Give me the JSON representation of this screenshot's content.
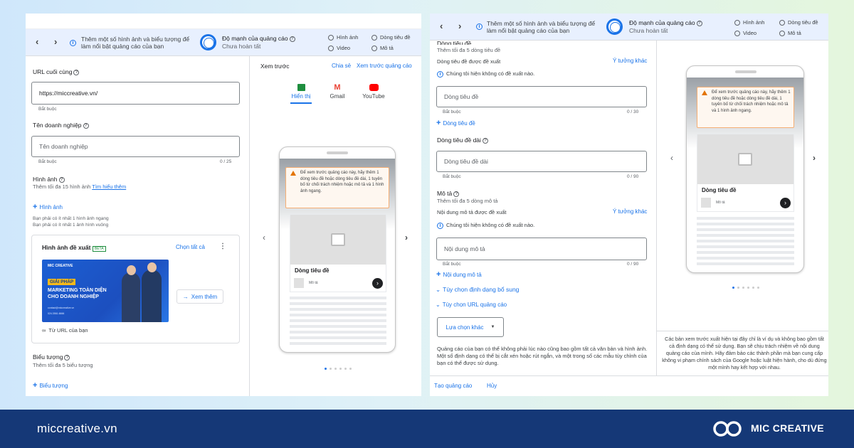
{
  "bar": {
    "message": [
      "Thêm một số hình ảnh và biểu tượng để",
      "làm nổi bật quảng cáo của bạn"
    ],
    "strength_label": "Độ mạnh của quảng cáo",
    "strength_status": "Chưa hoàn tất",
    "checks": [
      "Hình ảnh",
      "Dòng tiêu đề",
      "Video",
      "Mô tả"
    ]
  },
  "left_form": {
    "final_url_label": "URL cuối cùng",
    "final_url_value": "https://miccreative.vn/",
    "required": "Bắt buộc",
    "business_label": "Tên doanh nghiệp",
    "business_placeholder": "Tên doanh nghiệp",
    "business_count": "0 / 25",
    "images_label": "Hình ảnh",
    "images_hint": "Thêm tối đa 15 hình ảnh",
    "learn_more": "Tìm hiểu thêm",
    "add_image": "Hình ảnh",
    "req1": "Bạn phải có ít nhất 1 hình ảnh ngang",
    "req2": "Bạn phải có ít nhất 1 ảnh hình vuông",
    "suggested_label": "Hình ảnh đề xuất",
    "beta": "BETA",
    "select_all": "Chọn tất cả",
    "view_more": "Xem thêm",
    "from_url": "Từ URL của bạn",
    "logo_label": "Biểu tượng",
    "logo_hint": "Thêm tối đa 5 biểu tượng",
    "add_logo": "Biểu tượng"
  },
  "banner": {
    "brand": "MIC CREATIVE",
    "tag": "GIẢI PHÁP",
    "line1": "MARKETING TOÀN DIỆN",
    "line2": "CHO DOANH NGHIỆP",
    "contact1": "contact@miccreative.vn",
    "contact2": "024.3561.6666"
  },
  "preview": {
    "title": "Xem trước",
    "share": "Chia sẻ",
    "preview_ads": "Xem trước quảng cáo",
    "tabs": [
      "Hiển thị",
      "Gmail",
      "YouTube"
    ],
    "warning": "Để xem trước quảng cáo này, hãy thêm 1 dòng tiêu đề hoặc dòng tiêu đề dài, 1 tuyên bố từ chối trách nhiệm hoặc mô tả và 1 hình ảnh ngang.",
    "headline": "Dòng tiêu đề",
    "desc": "Mô tả",
    "disclaimer": "Các bản xem trước xuất hiện tại đây chỉ là ví dụ và không bao gồm tất cả định dạng có thể sử dụng. Bạn sẽ chịu trách nhiệm về nội dung quảng cáo của mình. Hãy đảm bảo các thành phần mà bạn cung cấp không vi phạm chính sách của Google hoặc luật hiện hành, cho dù đứng một mình hay kết hợp với nhau."
  },
  "right_form": {
    "top_label": "Dòng tiêu đề",
    "top_hint": "Thêm tối đa 5 dòng tiêu đề",
    "suggested_headline": "Dòng tiêu đề được đề xuất",
    "other_ideas": "Ý tưởng khác",
    "no_suggestions": "Chúng tôi hiện không có đề xuất nào.",
    "headline_placeholder": "Dòng tiêu đề",
    "required": "Bắt buộc",
    "count30": "0 / 30",
    "add_headline": "Dòng tiêu đề",
    "long_label": "Dòng tiêu đề dài",
    "long_placeholder": "Dòng tiêu đề dài",
    "count90": "0 / 90",
    "desc_label": "Mô tả",
    "desc_hint": "Thêm tối đa 5 dòng mô tả",
    "suggested_desc": "Nội dung mô tả được đề xuất",
    "desc_placeholder": "Nội dung mô tả",
    "add_desc": "Nội dung mô tả",
    "format_options": "Tùy chọn định dạng bổ sung",
    "url_options": "Tùy chọn URL quảng cáo",
    "more_options": "Lựa chọn khác",
    "note": "Quảng cáo của bạn có thể không phải lúc nào cũng bao gồm tất cả văn bản và hình ảnh. Một số định dạng có thể bị cắt xén hoặc rút ngắn, và một trong số các mẫu tùy chỉnh của bạn có thể được sử dụng.",
    "create_ad": "Tạo quảng cáo",
    "cancel": "Hủy"
  },
  "footer": {
    "site": "miccreative.vn",
    "brand": "MIC CREATIVE"
  },
  "colors": {
    "accent": "#1a73e8",
    "footer_bg": "#153877",
    "warning": "#e37400"
  }
}
